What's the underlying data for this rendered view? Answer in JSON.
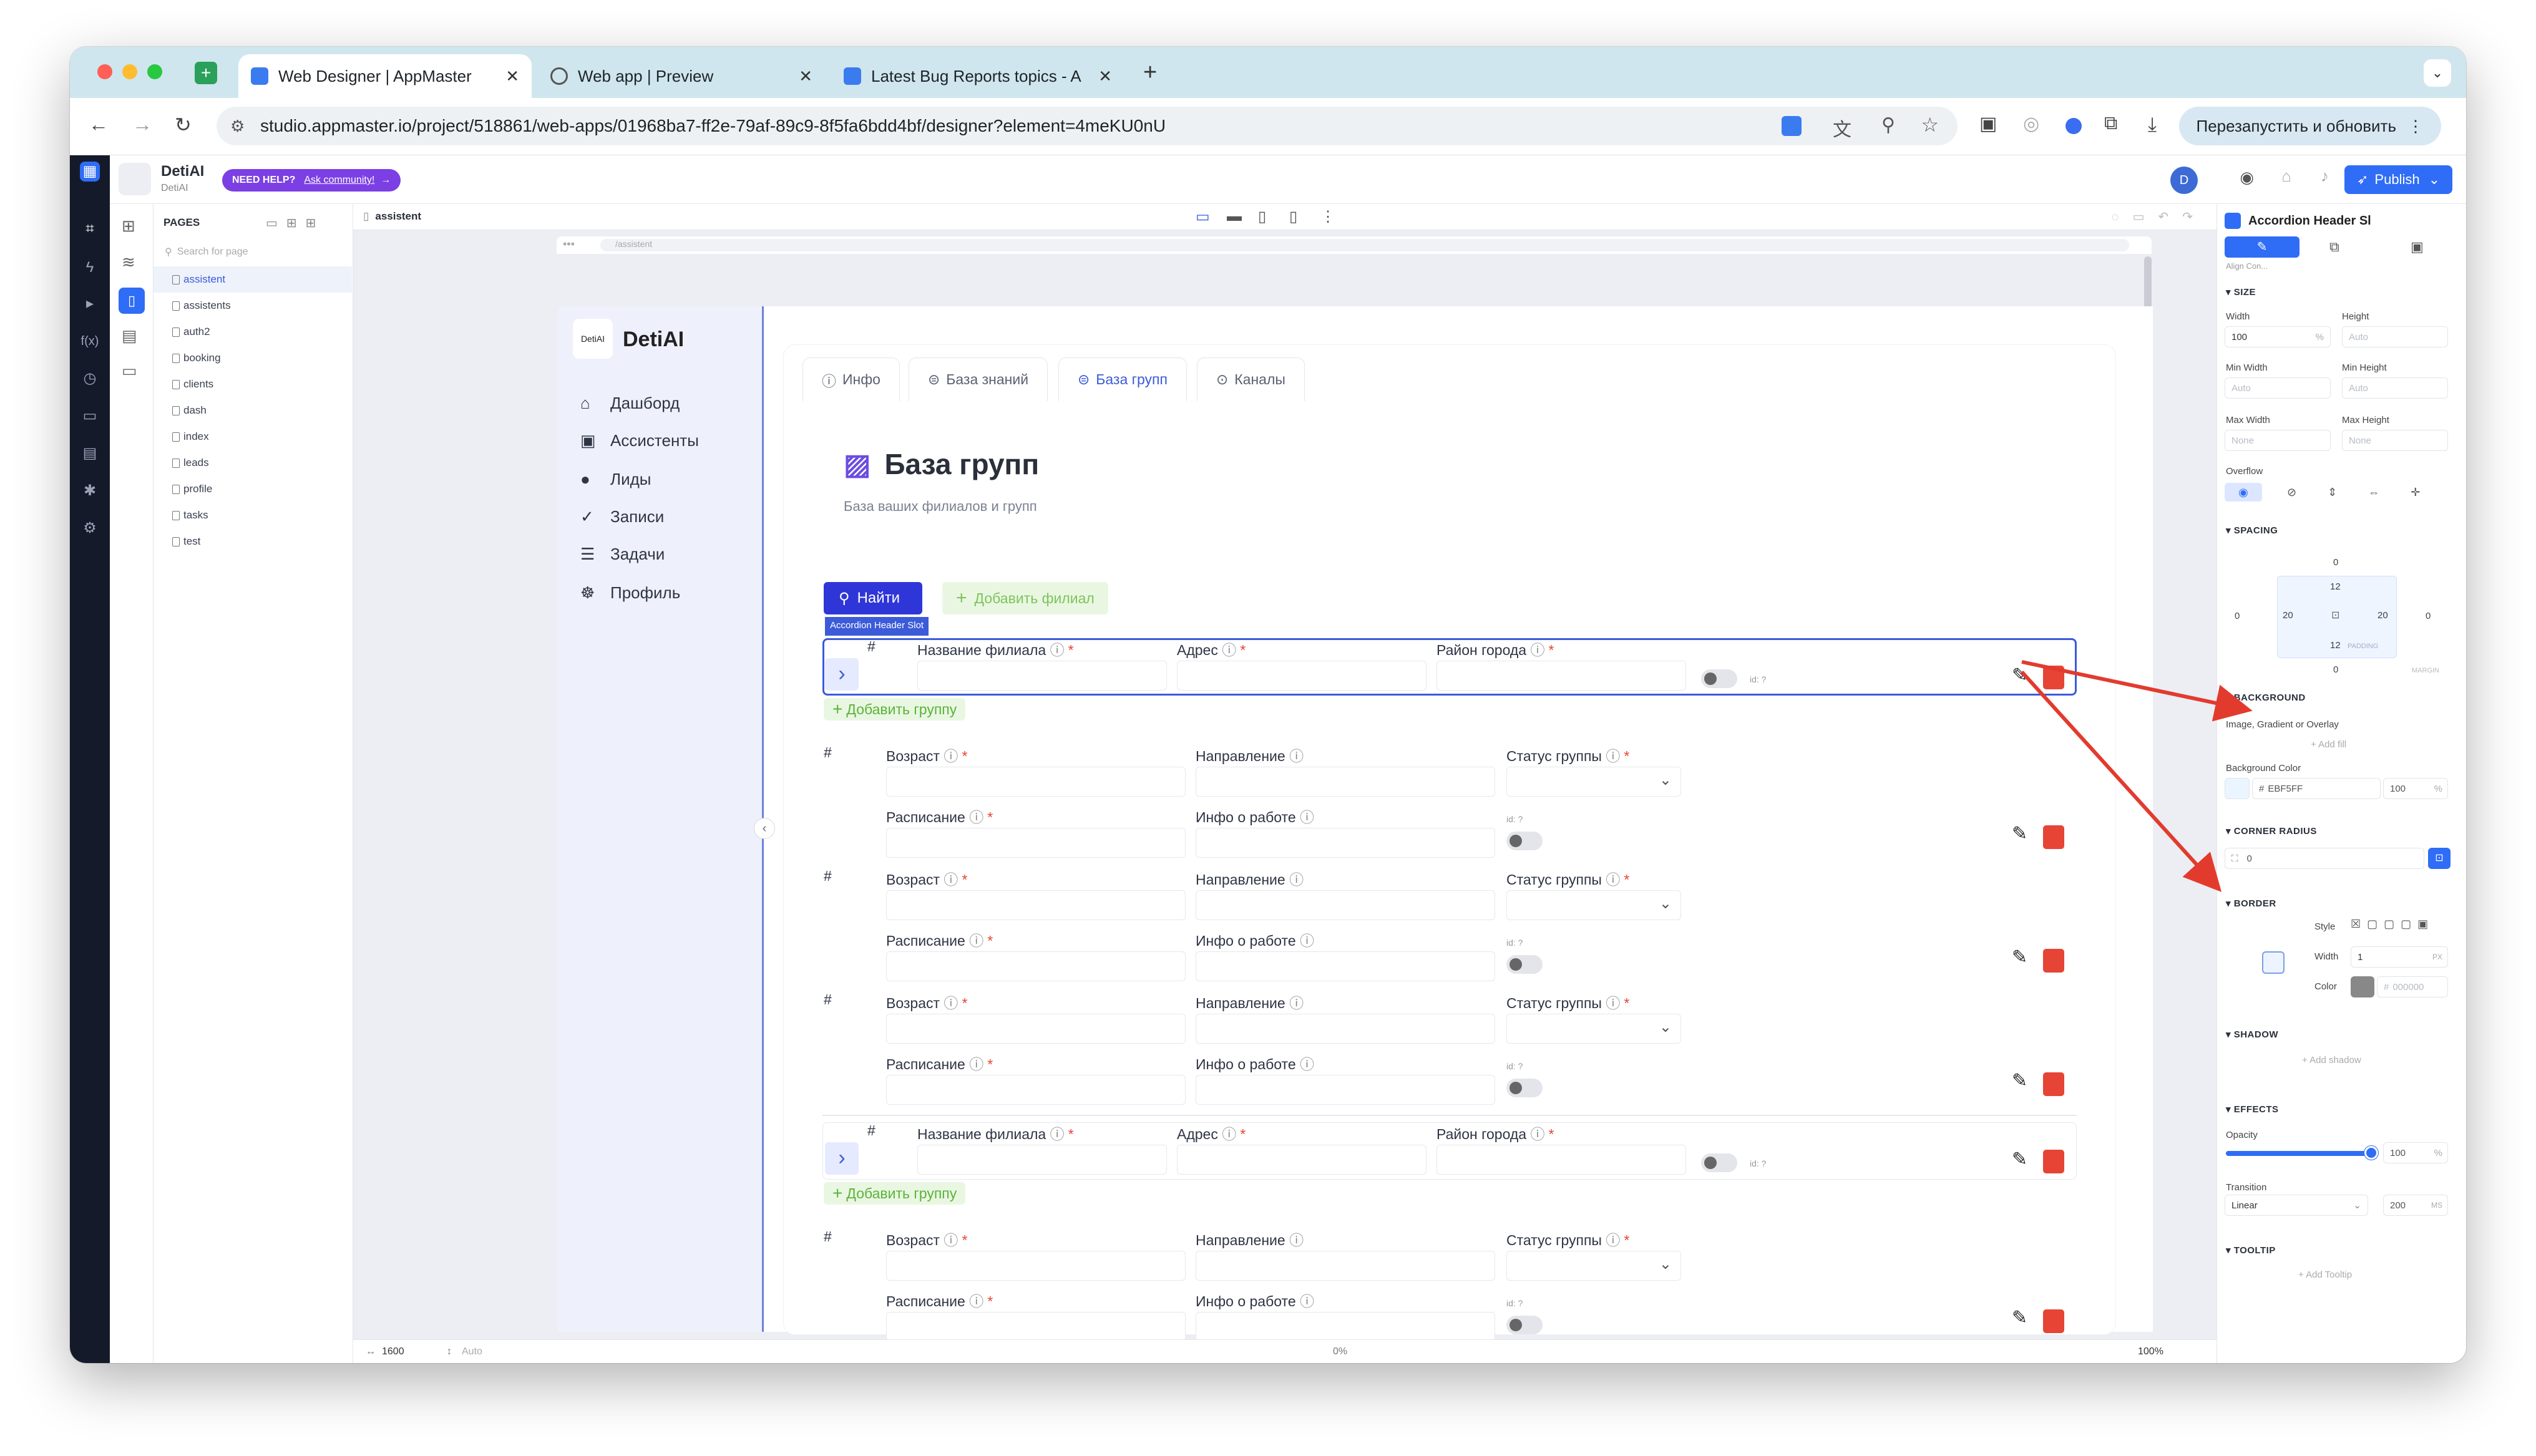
{
  "browser": {
    "tabs": [
      {
        "label": "Web Designer | AppMaster",
        "active": true
      },
      {
        "label": "Web app | Preview",
        "active": false
      },
      {
        "label": "Latest Bug Reports topics - A",
        "active": false
      }
    ],
    "url": "studio.appmaster.io/project/518861/web-apps/01968ba7-ff2e-79af-89c9-8f5fa6bdd4bf/designer?element=4meKU0nU",
    "profile_initial": "D",
    "relaunch_label": "Перезапустить и обновить"
  },
  "app": {
    "project_name": "DetiAI",
    "project_sub": "DetiAI",
    "help_badge": "NEED HELP?",
    "help_link": "Ask community!",
    "user_initial": "D",
    "publish_label": "Publish"
  },
  "pages_panel": {
    "title": "PAGES",
    "search_placeholder": "Search for page",
    "items": [
      "assistent",
      "assistents",
      "auth2",
      "booking",
      "clients",
      "dash",
      "index",
      "leads",
      "profile",
      "tasks",
      "test"
    ],
    "selected": "assistent"
  },
  "canvas": {
    "breadcrumb": "assistent",
    "preview_url": "/assistent",
    "width_value": "1600",
    "height_value": "Auto",
    "zoom": "100%",
    "offset": "0%"
  },
  "inner_app": {
    "logo_text": "DetiAI",
    "brand": "DetiAI",
    "menu": [
      {
        "label": "Дашборд",
        "icon": "home-icon"
      },
      {
        "label": "Ассистенты",
        "icon": "assistant-icon"
      },
      {
        "label": "Лиды",
        "icon": "person-icon"
      },
      {
        "label": "Записи",
        "icon": "check-icon"
      },
      {
        "label": "Задачи",
        "icon": "list-icon"
      },
      {
        "label": "Профиль",
        "icon": "settings-icon"
      }
    ],
    "tabs": [
      "Инфо",
      "База знаний",
      "База групп",
      "Каналы"
    ],
    "active_tab": "База групп",
    "heading": "База групп",
    "subheading": "База ваших филиалов и групп",
    "search_btn": "Найти",
    "add_branch_btn": "Добавить филиал",
    "selection_label": "Accordion Header Slot",
    "branch_fields": {
      "num": "#",
      "name": "Название филиала",
      "address": "Адрес",
      "district": "Район города",
      "id": "id: ?"
    },
    "add_group_btn": "Добавить группу",
    "group_fields": {
      "num": "#",
      "age": "Возраст",
      "direction": "Направление",
      "status": "Статус группы",
      "schedule": "Расписание",
      "info": "Инфо о работе",
      "id": "id: ?"
    },
    "required_mark": "*"
  },
  "properties": {
    "element_title": "Accordion Header Sl",
    "align_label": "Align Con...",
    "size": {
      "title": "SIZE",
      "width_label": "Width",
      "width_value": "100",
      "width_unit": "%",
      "height_label": "Height",
      "height_value": "Auto",
      "min_width_label": "Min Width",
      "min_width_value": "Auto",
      "min_height_label": "Min Height",
      "min_height_value": "Auto",
      "max_width_label": "Max Width",
      "max_width_value": "None",
      "max_height_label": "Max Height",
      "max_height_value": "None",
      "overflow_label": "Overflow"
    },
    "spacing": {
      "title": "SPACING",
      "margin_top": "0",
      "margin_left": "0",
      "margin_right": "0",
      "margin_bottom": "0",
      "padding_top": "12",
      "padding_left": "20",
      "padding_right": "20",
      "padding_bottom": "12",
      "padding_label": "PADDING",
      "margin_label": "MARGIN"
    },
    "background": {
      "title": "BACKGROUND",
      "image_label": "Image, Gradient or Overlay",
      "add_fill": "+ Add fill",
      "color_label": "Background Color",
      "color_value": "EBF5FF",
      "color_hex": "#EBF5FF",
      "opacity": "100",
      "opacity_unit": "%"
    },
    "corner_radius": {
      "title": "CORNER RADIUS",
      "value": "0"
    },
    "border": {
      "title": "BORDER",
      "style_label": "Style",
      "width_label": "Width",
      "width_value": "1",
      "width_unit": "PX",
      "color_label": "Color",
      "color_value": "000000"
    },
    "shadow": {
      "title": "SHADOW",
      "add": "+ Add shadow"
    },
    "effects": {
      "title": "EFFECTS",
      "opacity_label": "Opacity",
      "opacity_value": "100",
      "opacity_unit": "%",
      "opacity_level": 1.0,
      "transition_label": "Transition",
      "transition_value": "Linear",
      "transition_ms": "200",
      "ms_unit": "MS"
    },
    "tooltip": {
      "title": "TOOLTIP",
      "add": "+ Add Tooltip"
    }
  },
  "colors": {
    "accent": "#3b5bd9",
    "publish": "#2f6df6",
    "annotation_arrow": "#e23b2e",
    "delete": "#e64435",
    "add_green": "#5cb33a"
  }
}
